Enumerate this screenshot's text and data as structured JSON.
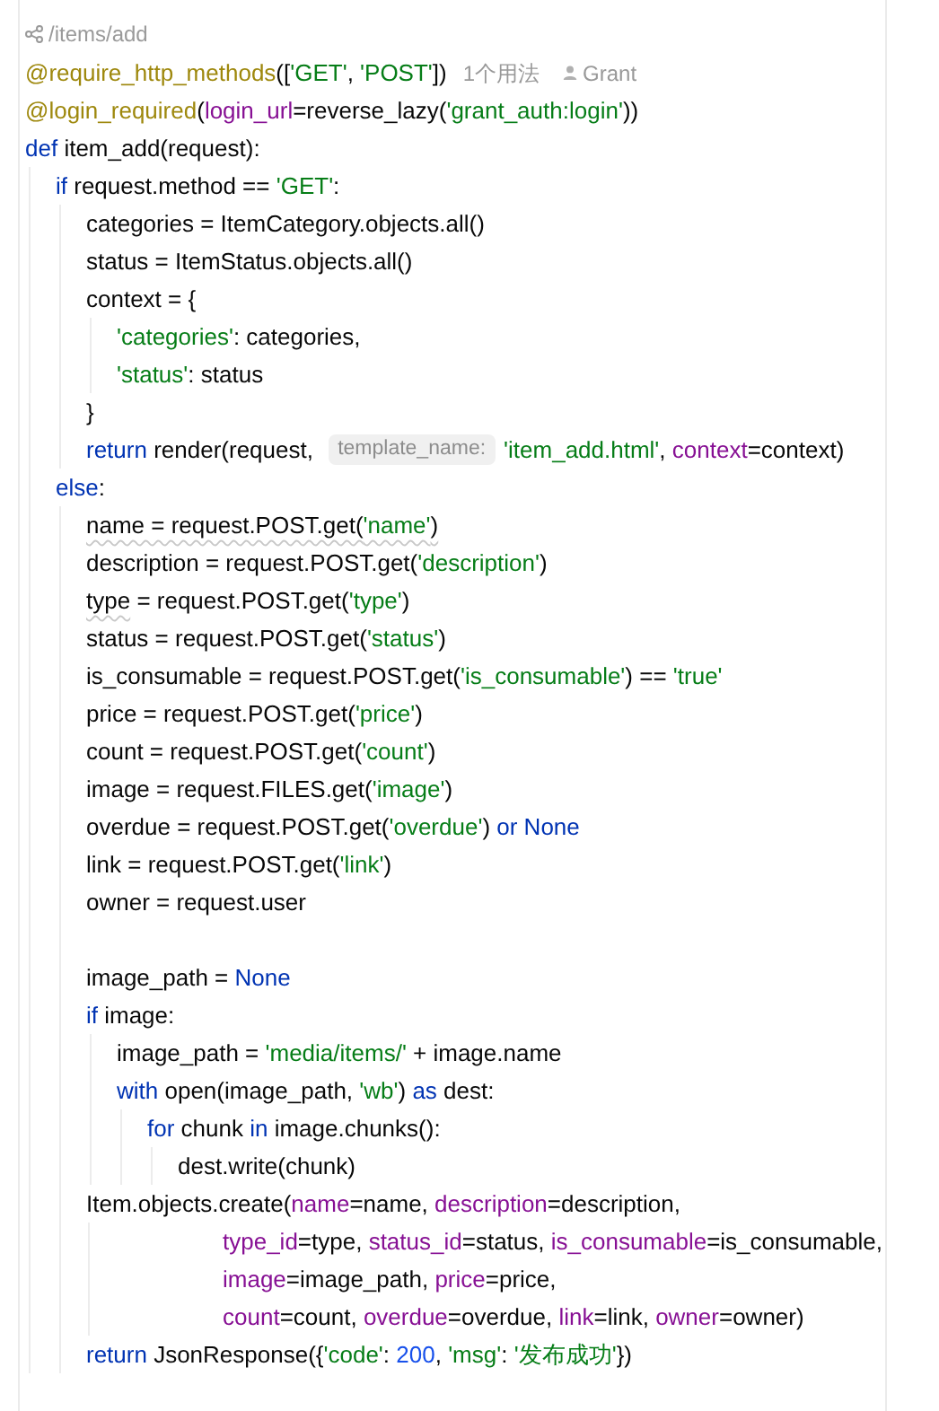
{
  "breadcrumb": {
    "path": "/items/add"
  },
  "lines": [
    {
      "tokens": [
        {
          "kind": "decorator",
          "text": "@require_http_methods"
        },
        {
          "kind": "plain",
          "text": "(["
        },
        {
          "kind": "string",
          "text": "'GET'"
        },
        {
          "kind": "plain",
          "text": ", "
        },
        {
          "kind": "string",
          "text": "'POST'"
        },
        {
          "kind": "plain",
          "text": "])"
        },
        {
          "kind": "usage",
          "text": "1个用法"
        },
        {
          "kind": "author",
          "text": "Grant"
        }
      ]
    },
    {
      "tokens": [
        {
          "kind": "decorator",
          "text": "@login_required"
        },
        {
          "kind": "plain",
          "text": "("
        },
        {
          "kind": "param",
          "text": "login_url"
        },
        {
          "kind": "plain",
          "text": "=reverse_lazy("
        },
        {
          "kind": "string",
          "text": "'grant_auth:login'"
        },
        {
          "kind": "plain",
          "text": "))"
        }
      ]
    },
    {
      "tokens": [
        {
          "kind": "keyword",
          "text": "def"
        },
        {
          "kind": "plain",
          "text": " item_add(request):"
        }
      ],
      "children": [
        {
          "tokens": [
            {
              "kind": "keyword",
              "text": "if"
            },
            {
              "kind": "plain",
              "text": " request.method == "
            },
            {
              "kind": "string",
              "text": "'GET'"
            },
            {
              "kind": "plain",
              "text": ":"
            }
          ],
          "children": [
            {
              "tokens": [
                {
                  "kind": "plain",
                  "text": "categories = ItemCategory.objects.all()"
                }
              ]
            },
            {
              "tokens": [
                {
                  "kind": "plain",
                  "text": "status = ItemStatus.objects.all()"
                }
              ]
            },
            {
              "tokens": [
                {
                  "kind": "plain",
                  "text": "context = {"
                }
              ],
              "children": [
                {
                  "tokens": [
                    {
                      "kind": "string",
                      "text": "'categories'"
                    },
                    {
                      "kind": "plain",
                      "text": ": categories,"
                    }
                  ]
                },
                {
                  "tokens": [
                    {
                      "kind": "string",
                      "text": "'status'"
                    },
                    {
                      "kind": "plain",
                      "text": ": status"
                    }
                  ]
                }
              ]
            },
            {
              "tokens": [
                {
                  "kind": "plain",
                  "text": "}"
                }
              ]
            },
            {
              "tokens": [
                {
                  "kind": "keyword",
                  "text": "return"
                },
                {
                  "kind": "plain",
                  "text": " render(request, "
                },
                {
                  "kind": "hint",
                  "text": "template_name:"
                },
                {
                  "kind": "string",
                  "text": "'item_add.html'"
                },
                {
                  "kind": "plain",
                  "text": ", "
                },
                {
                  "kind": "param",
                  "text": "context"
                },
                {
                  "kind": "plain",
                  "text": "=context)"
                }
              ]
            }
          ]
        },
        {
          "tokens": [
            {
              "kind": "keyword",
              "text": "else"
            },
            {
              "kind": "plain",
              "text": ":"
            }
          ],
          "children": [
            {
              "tokens": [
                {
                  "kind": "plain",
                  "text": "name = request.POST.get(",
                  "warning": true
                },
                {
                  "kind": "string",
                  "text": "'name'",
                  "warning": true
                },
                {
                  "kind": "plain",
                  "text": ")",
                  "warning": true
                }
              ]
            },
            {
              "tokens": [
                {
                  "kind": "plain",
                  "text": "description = request.POST.get("
                },
                {
                  "kind": "string",
                  "text": "'description'"
                },
                {
                  "kind": "plain",
                  "text": ")"
                }
              ]
            },
            {
              "tokens": [
                {
                  "kind": "plain",
                  "text": "type",
                  "warning": true
                },
                {
                  "kind": "plain",
                  "text": " = request.POST.get("
                },
                {
                  "kind": "string",
                  "text": "'type'"
                },
                {
                  "kind": "plain",
                  "text": ")"
                }
              ]
            },
            {
              "tokens": [
                {
                  "kind": "plain",
                  "text": "status = request.POST.get("
                },
                {
                  "kind": "string",
                  "text": "'status'"
                },
                {
                  "kind": "plain",
                  "text": ")"
                }
              ]
            },
            {
              "tokens": [
                {
                  "kind": "plain",
                  "text": "is_consumable = request.POST.get("
                },
                {
                  "kind": "string",
                  "text": "'is_consumable'"
                },
                {
                  "kind": "plain",
                  "text": ") == "
                },
                {
                  "kind": "string",
                  "text": "'true'"
                }
              ]
            },
            {
              "tokens": [
                {
                  "kind": "plain",
                  "text": "price = request.POST.get("
                },
                {
                  "kind": "string",
                  "text": "'price'"
                },
                {
                  "kind": "plain",
                  "text": ")"
                }
              ]
            },
            {
              "tokens": [
                {
                  "kind": "plain",
                  "text": "count = request.POST.get("
                },
                {
                  "kind": "string",
                  "text": "'count'"
                },
                {
                  "kind": "plain",
                  "text": ")"
                }
              ]
            },
            {
              "tokens": [
                {
                  "kind": "plain",
                  "text": "image = request.FILES.get("
                },
                {
                  "kind": "string",
                  "text": "'image'"
                },
                {
                  "kind": "plain",
                  "text": ")"
                }
              ]
            },
            {
              "tokens": [
                {
                  "kind": "plain",
                  "text": "overdue = request.POST.get("
                },
                {
                  "kind": "string",
                  "text": "'overdue'"
                },
                {
                  "kind": "plain",
                  "text": ") "
                },
                {
                  "kind": "keyword",
                  "text": "or None"
                }
              ]
            },
            {
              "tokens": [
                {
                  "kind": "plain",
                  "text": "link = request.POST.get("
                },
                {
                  "kind": "string",
                  "text": "'link'"
                },
                {
                  "kind": "plain",
                  "text": ")"
                }
              ]
            },
            {
              "tokens": [
                {
                  "kind": "plain",
                  "text": "owner = request.user"
                }
              ]
            },
            {
              "gap_before": true,
              "tokens": [
                {
                  "kind": "plain",
                  "text": "image_path = "
                },
                {
                  "kind": "keyword",
                  "text": "None"
                }
              ]
            },
            {
              "tokens": [
                {
                  "kind": "keyword",
                  "text": "if"
                },
                {
                  "kind": "plain",
                  "text": " image:"
                }
              ],
              "children": [
                {
                  "tokens": [
                    {
                      "kind": "plain",
                      "text": "image_path = "
                    },
                    {
                      "kind": "string",
                      "text": "'media/items/'"
                    },
                    {
                      "kind": "plain",
                      "text": " + image.name"
                    }
                  ]
                },
                {
                  "tokens": [
                    {
                      "kind": "keyword",
                      "text": "with"
                    },
                    {
                      "kind": "plain",
                      "text": " open(image_path, "
                    },
                    {
                      "kind": "string",
                      "text": "'wb'"
                    },
                    {
                      "kind": "plain",
                      "text": ") "
                    },
                    {
                      "kind": "keyword",
                      "text": "as"
                    },
                    {
                      "kind": "plain",
                      "text": " dest:"
                    }
                  ],
                  "children": [
                    {
                      "tokens": [
                        {
                          "kind": "keyword",
                          "text": "for"
                        },
                        {
                          "kind": "plain",
                          "text": " chunk "
                        },
                        {
                          "kind": "keyword",
                          "text": "in"
                        },
                        {
                          "kind": "plain",
                          "text": " image.chunks():"
                        }
                      ],
                      "children": [
                        {
                          "tokens": [
                            {
                              "kind": "plain",
                              "text": "dest.write(chunk)"
                            }
                          ]
                        }
                      ]
                    }
                  ]
                }
              ]
            },
            {
              "tokens": [
                {
                  "kind": "plain",
                  "text": "Item.objects.create("
                },
                {
                  "kind": "param",
                  "text": "name"
                },
                {
                  "kind": "plain",
                  "text": "=name, "
                },
                {
                  "kind": "param",
                  "text": "description"
                },
                {
                  "kind": "plain",
                  "text": "=description,"
                }
              ],
              "continuation": [
                {
                  "tokens": [
                    {
                      "kind": "param",
                      "text": "type_id"
                    },
                    {
                      "kind": "plain",
                      "text": "=type, "
                    },
                    {
                      "kind": "param",
                      "text": "status_id"
                    },
                    {
                      "kind": "plain",
                      "text": "=status, "
                    },
                    {
                      "kind": "param",
                      "text": "is_consumable"
                    },
                    {
                      "kind": "plain",
                      "text": "=is_consumable,"
                    }
                  ]
                },
                {
                  "tokens": [
                    {
                      "kind": "param",
                      "text": "image"
                    },
                    {
                      "kind": "plain",
                      "text": "=image_path, "
                    },
                    {
                      "kind": "param",
                      "text": "price"
                    },
                    {
                      "kind": "plain",
                      "text": "=price,"
                    }
                  ]
                },
                {
                  "tokens": [
                    {
                      "kind": "param",
                      "text": "count"
                    },
                    {
                      "kind": "plain",
                      "text": "=count, "
                    },
                    {
                      "kind": "param",
                      "text": "overdue"
                    },
                    {
                      "kind": "plain",
                      "text": "=overdue, "
                    },
                    {
                      "kind": "param",
                      "text": "link"
                    },
                    {
                      "kind": "plain",
                      "text": "=link, "
                    },
                    {
                      "kind": "param",
                      "text": "owner"
                    },
                    {
                      "kind": "plain",
                      "text": "=owner)"
                    }
                  ]
                }
              ]
            },
            {
              "tokens": [
                {
                  "kind": "keyword",
                  "text": "return"
                },
                {
                  "kind": "plain",
                  "text": " JsonResponse({"
                },
                {
                  "kind": "string",
                  "text": "'code'"
                },
                {
                  "kind": "plain",
                  "text": ": "
                },
                {
                  "kind": "number",
                  "text": "200"
                },
                {
                  "kind": "plain",
                  "text": ", "
                },
                {
                  "kind": "string",
                  "text": "'msg'"
                },
                {
                  "kind": "plain",
                  "text": ": "
                },
                {
                  "kind": "string",
                  "text": "'发布成功'"
                },
                {
                  "kind": "plain",
                  "text": "})"
                }
              ]
            }
          ]
        }
      ]
    }
  ]
}
